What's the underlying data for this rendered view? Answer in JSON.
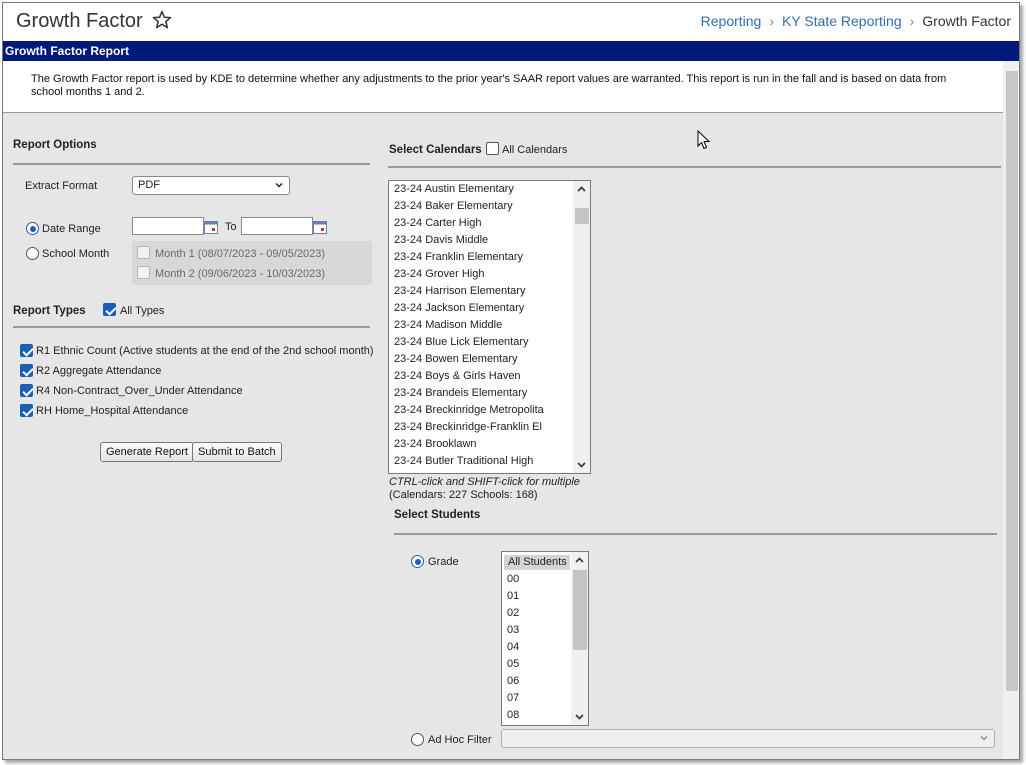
{
  "header": {
    "title": "Growth Factor",
    "breadcrumb": [
      "Reporting",
      "KY State Reporting",
      "Growth Factor"
    ]
  },
  "report": {
    "bar_title": "Growth Factor Report",
    "description": "The Growth Factor report is used by KDE to determine whether any adjustments to the prior year's SAAR report values are warranted. This report is run in the fall and is based on data from school months 1 and 2."
  },
  "options": {
    "title": "Report Options",
    "extract_format_label": "Extract Format",
    "extract_format_value": "PDF",
    "date_range_label": "Date Range",
    "to_label": "To",
    "school_month_label": "School Month",
    "month1": "Month 1 (08/07/2023 - 09/05/2023)",
    "month2": "Month 2 (09/06/2023 - 10/03/2023)",
    "date_range_selected": true
  },
  "types": {
    "title": "Report Types",
    "all_label": "All Types",
    "items": [
      {
        "label": "R1 Ethnic Count (Active students at the end of the 2nd school month)",
        "checked": true
      },
      {
        "label": "R2 Aggregate Attendance",
        "checked": true
      },
      {
        "label": "R4 Non-Contract_Over_Under Attendance",
        "checked": true
      },
      {
        "label": "RH Home_Hospital Attendance",
        "checked": true
      }
    ]
  },
  "buttons": {
    "generate": "Generate Report",
    "batch": "Submit to Batch"
  },
  "calendars": {
    "title": "Select Calendars",
    "all_label": "All Calendars",
    "items": [
      "23-24 Austin Elementary",
      "23-24 Baker Elementary",
      "23-24 Carter High",
      "23-24 Davis Middle",
      "23-24 Franklin Elementary",
      "23-24 Grover High",
      "23-24 Harrison Elementary",
      "23-24 Jackson Elementary",
      "23-24 Madison Middle",
      "23-24 Blue Lick Elementary",
      "23-24 Bowen Elementary",
      "23-24 Boys & Girls Haven",
      "23-24 Brandeis Elementary",
      "23-24 Breckinridge Metropolita",
      "23-24 Breckinridge-Franklin El",
      "23-24 Brooklawn",
      "23-24 Butler Traditional High"
    ],
    "hint": "CTRL-click and SHIFT-click for multiple",
    "counts": "(Calendars: 227  Schools: 168)"
  },
  "students": {
    "title": "Select Students",
    "grade_label": "Grade",
    "grades": [
      "All Students",
      "00",
      "01",
      "02",
      "03",
      "04",
      "05",
      "06",
      "07",
      "08"
    ],
    "adhoc_label": "Ad Hoc Filter"
  },
  "colors": {
    "accent": "#1a5fb4",
    "bar": "#001a7a",
    "link": "#2f6fb0"
  }
}
